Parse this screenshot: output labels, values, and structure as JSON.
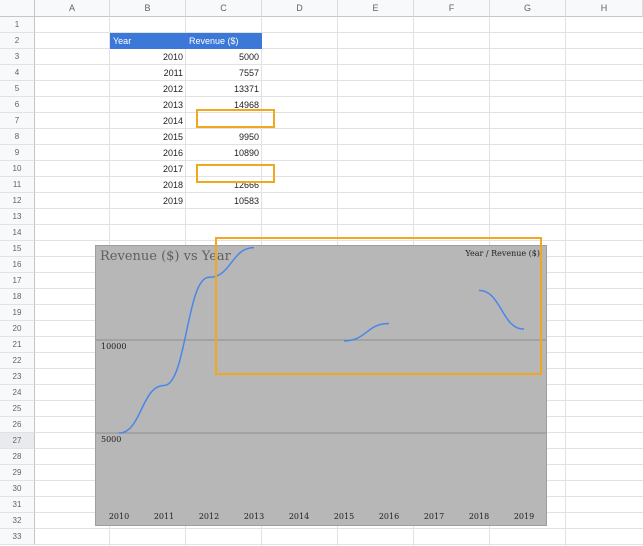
{
  "columns": [
    "A",
    "B",
    "C",
    "D",
    "E",
    "F",
    "G",
    "H"
  ],
  "rows": [
    "1",
    "2",
    "3",
    "4",
    "5",
    "6",
    "7",
    "8",
    "9",
    "10",
    "11",
    "12",
    "13",
    "14",
    "15",
    "16",
    "17",
    "18",
    "19",
    "20",
    "21",
    "22",
    "23",
    "24",
    "25",
    "26",
    "27",
    "28",
    "29",
    "30",
    "31",
    "32",
    "33"
  ],
  "selected_row": "27",
  "table": {
    "headers": [
      "Year",
      "Revenue ($)"
    ],
    "years": [
      "2010",
      "2011",
      "2012",
      "2013",
      "2014",
      "2015",
      "2016",
      "2017",
      "2018",
      "2019"
    ],
    "revenue": [
      "5000",
      "7557",
      "13371",
      "14968",
      "",
      "9950",
      "10890",
      "",
      "12666",
      "10583"
    ]
  },
  "chart_data": {
    "type": "line",
    "title": "Revenue ($) vs Year",
    "legend": "Year / Revenue ($)",
    "legend_position": "top-right",
    "categories": [
      "2010",
      "2011",
      "2012",
      "2013",
      "2014",
      "2015",
      "2016",
      "2017",
      "2018",
      "2019"
    ],
    "series": [
      {
        "name": "Year / Revenue ($)",
        "color": "#4a86e8",
        "values": [
          5000,
          7557,
          13371,
          14968,
          null,
          9950,
          10890,
          null,
          12666,
          10583
        ]
      }
    ],
    "y_ticks": [
      "5000",
      "10000"
    ],
    "ylim": [
      4000,
      16000
    ],
    "grid": true,
    "background": "#b7b7b7"
  },
  "annotation_color": "#f0a820"
}
